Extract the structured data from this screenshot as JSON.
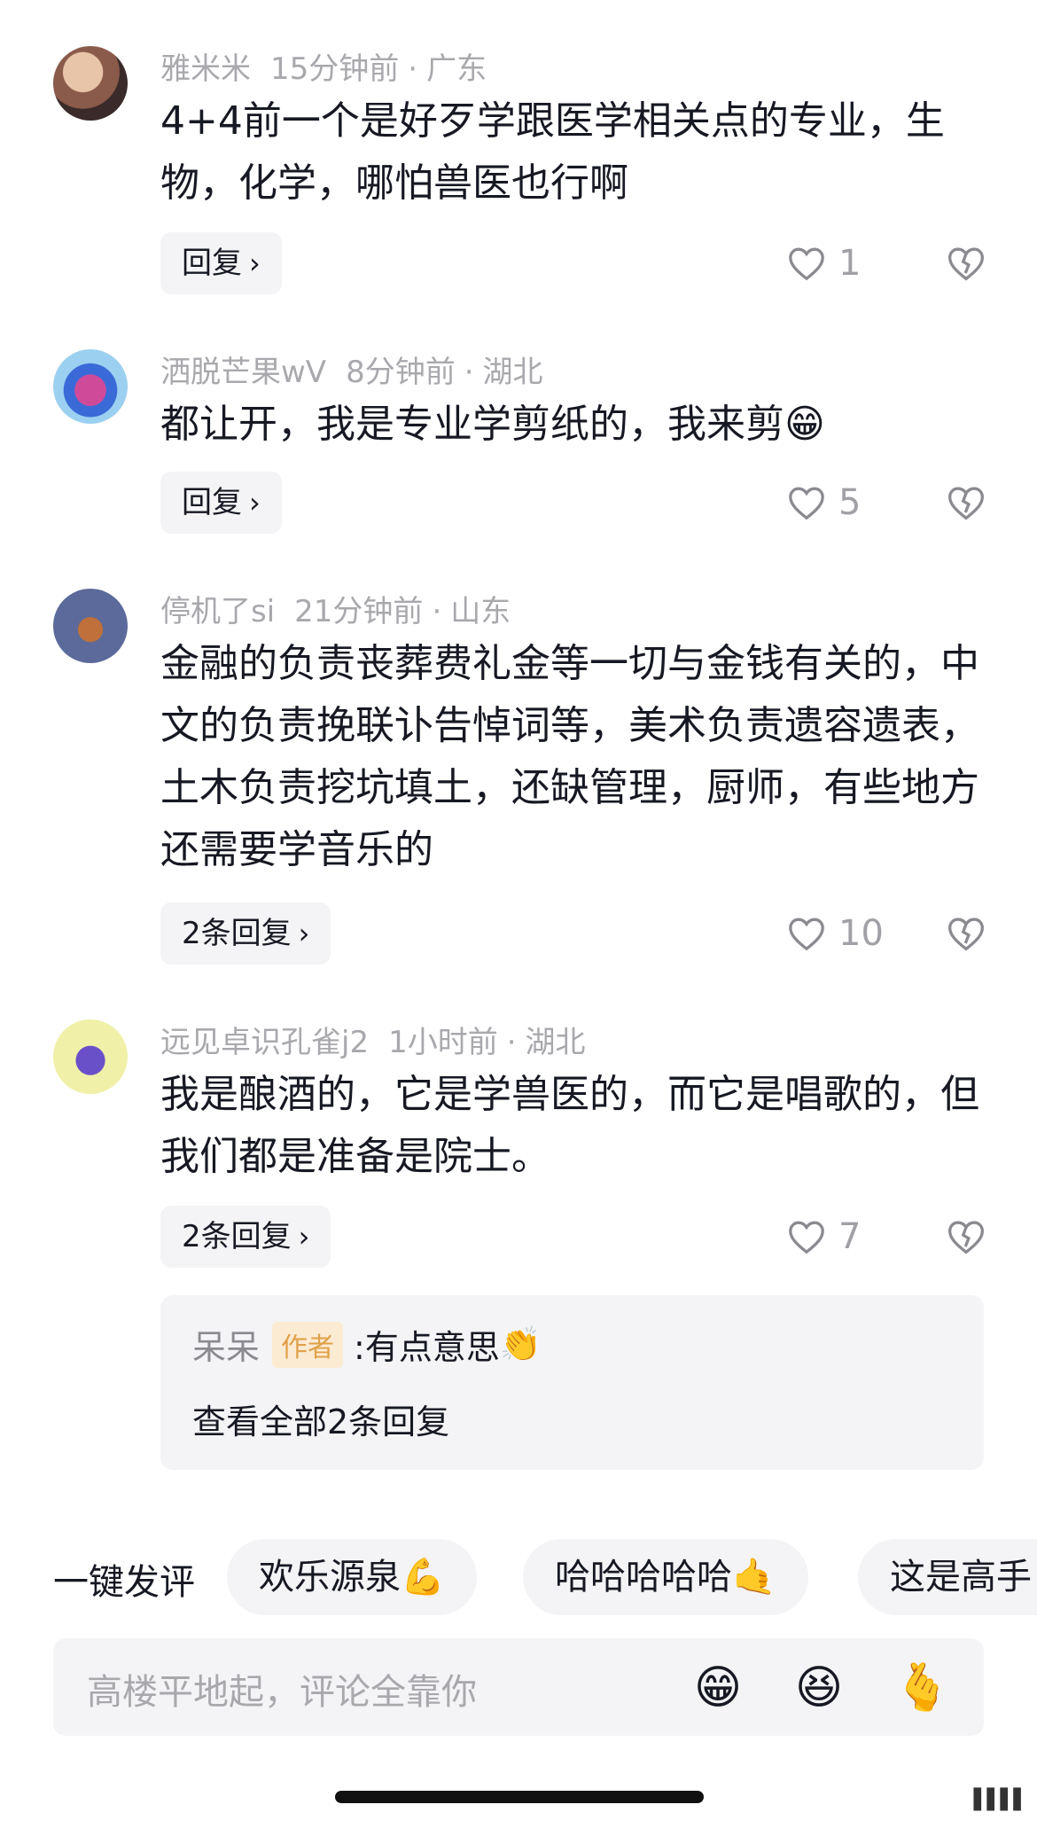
{
  "comments": [
    {
      "user": "雅米米",
      "time": "15分钟前",
      "location": "广东",
      "text": "4+4前一个是好歹学跟医学相关点的专业，生物，化学，哪怕兽医也行啊",
      "reply_label": "回复",
      "likes": "1"
    },
    {
      "user": "洒脱芒果wV",
      "time": "8分钟前",
      "location": "湖北",
      "text": "都让开，我是专业学剪纸的，我来剪",
      "text_emoji": "😁",
      "reply_label": "回复",
      "likes": "5"
    },
    {
      "user": "停机了si",
      "time": "21分钟前",
      "location": "山东",
      "text": "金融的负责丧葬费礼金等一切与金钱有关的，中文的负责挽联讣告悼词等，美术负责遗容遗表，土木负责挖坑填土，还缺管理，厨师，有些地方还需要学音乐的",
      "reply_label": "2条回复",
      "likes": "10"
    },
    {
      "user": "远见卓识孔雀j2",
      "time": "1小时前",
      "location": "湖北",
      "text": "我是酿酒的，它是学兽医的，而它是唱歌的，但我们都是准备是院士。",
      "reply_label": "2条回复",
      "likes": "7"
    }
  ],
  "author_reply": {
    "name": "呆呆",
    "badge": "作者",
    "text": ":有点意思",
    "emoji": "👏",
    "view_all": "查看全部2条回复"
  },
  "quick_comment": {
    "label": "一键发评",
    "chips": [
      {
        "text": "欢乐源泉",
        "emoji": "💪"
      },
      {
        "text": "哈哈哈哈哈",
        "emoji": "🤙"
      },
      {
        "text": "这是高手",
        "emoji": ""
      }
    ]
  },
  "input": {
    "placeholder": "高楼平地起，评论全靠你",
    "emojis": [
      "😁",
      "😆",
      "🫰"
    ]
  },
  "colors": {
    "text": "#161823",
    "meta": "#a8a8ad",
    "chip_bg": "#f4f4f6",
    "badge_bg": "#fcebd3",
    "badge_text": "#e0a14a"
  }
}
